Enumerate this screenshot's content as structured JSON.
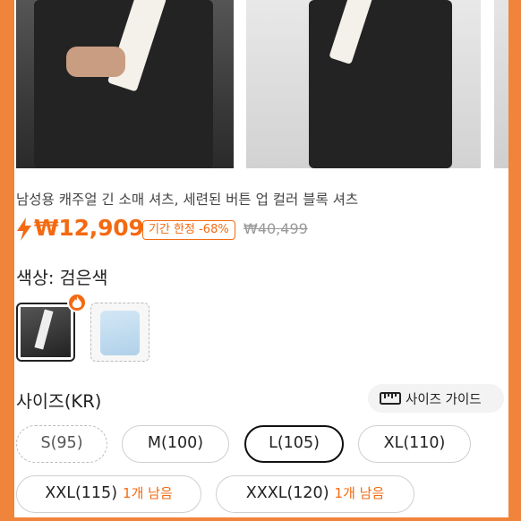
{
  "product": {
    "title": "남성용 캐주얼 긴 소매 셔츠, 세련된 버튼 업 컬러 블록 셔츠",
    "price": "₩12,909",
    "discount_badge": "기간 한정 -68%",
    "original_price": "₩40,499"
  },
  "color": {
    "label": "색상: 검은색",
    "options": [
      "black-white-scarf",
      "light-blue"
    ],
    "selected_index": 0
  },
  "size": {
    "label": "사이즈(KR)",
    "guide_label": "사이즈 가이드",
    "options": [
      {
        "label": "S(95)",
        "state": "unavailable"
      },
      {
        "label": "M(100)",
        "state": "available"
      },
      {
        "label": "L(105)",
        "state": "selected"
      },
      {
        "label": "XL(110)",
        "state": "available"
      },
      {
        "label": "XXL(115)",
        "stock_note": "1개 남음",
        "state": "available"
      },
      {
        "label": "XXXL(120)",
        "stock_note": "1개 남음",
        "state": "available"
      }
    ]
  },
  "colors": {
    "accent": "#f36a12",
    "edge": "#f1843b"
  }
}
